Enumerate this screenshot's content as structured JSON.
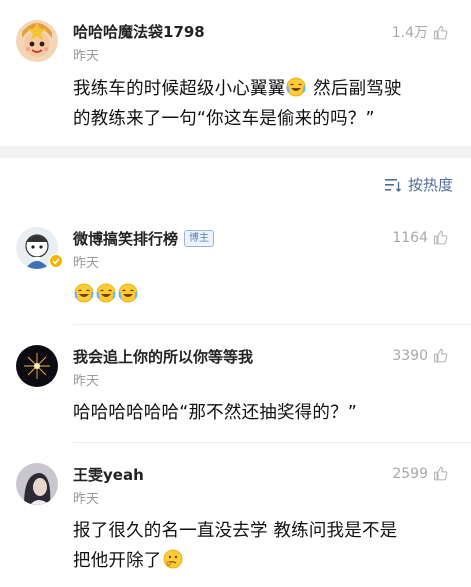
{
  "post": {
    "username": "哈哈哈魔法袋1798",
    "time": "昨天",
    "likes": "1.4万",
    "text_line1": "我练车的时候超级小心翼翼",
    "text_line1_tail": " 然后副驾驶",
    "text_line2": "的教练来了一句“你这车是偷来的吗？”",
    "emoji": "laugh-cry-emoji"
  },
  "sort": {
    "label": "按热度",
    "icon": "sort-lines-icon"
  },
  "comments": [
    {
      "username": "微博搞笑排行榜",
      "badge": "博主",
      "time": "昨天",
      "likes": "1164",
      "text": "",
      "emojis": [
        "laugh-cry-emoji",
        "laugh-cry-emoji",
        "laugh-cry-emoji"
      ]
    },
    {
      "username": "我会追上你的所以你等等我",
      "time": "昨天",
      "likes": "3390",
      "text": "哈哈哈哈哈哈“那不然还抽奖得的？”"
    },
    {
      "username": "王雯yeah",
      "time": "昨天",
      "likes": "2599",
      "text_line1": "报了很久的名一直没去学 教练问我是不是",
      "text_line2": "把他开除了",
      "emoji": "thinking-emoji"
    }
  ],
  "colors": {
    "link_blue": "#4f6f9a",
    "muted": "#999999",
    "divider": "#ebebeb",
    "section_gap": "#f2f2f2"
  }
}
